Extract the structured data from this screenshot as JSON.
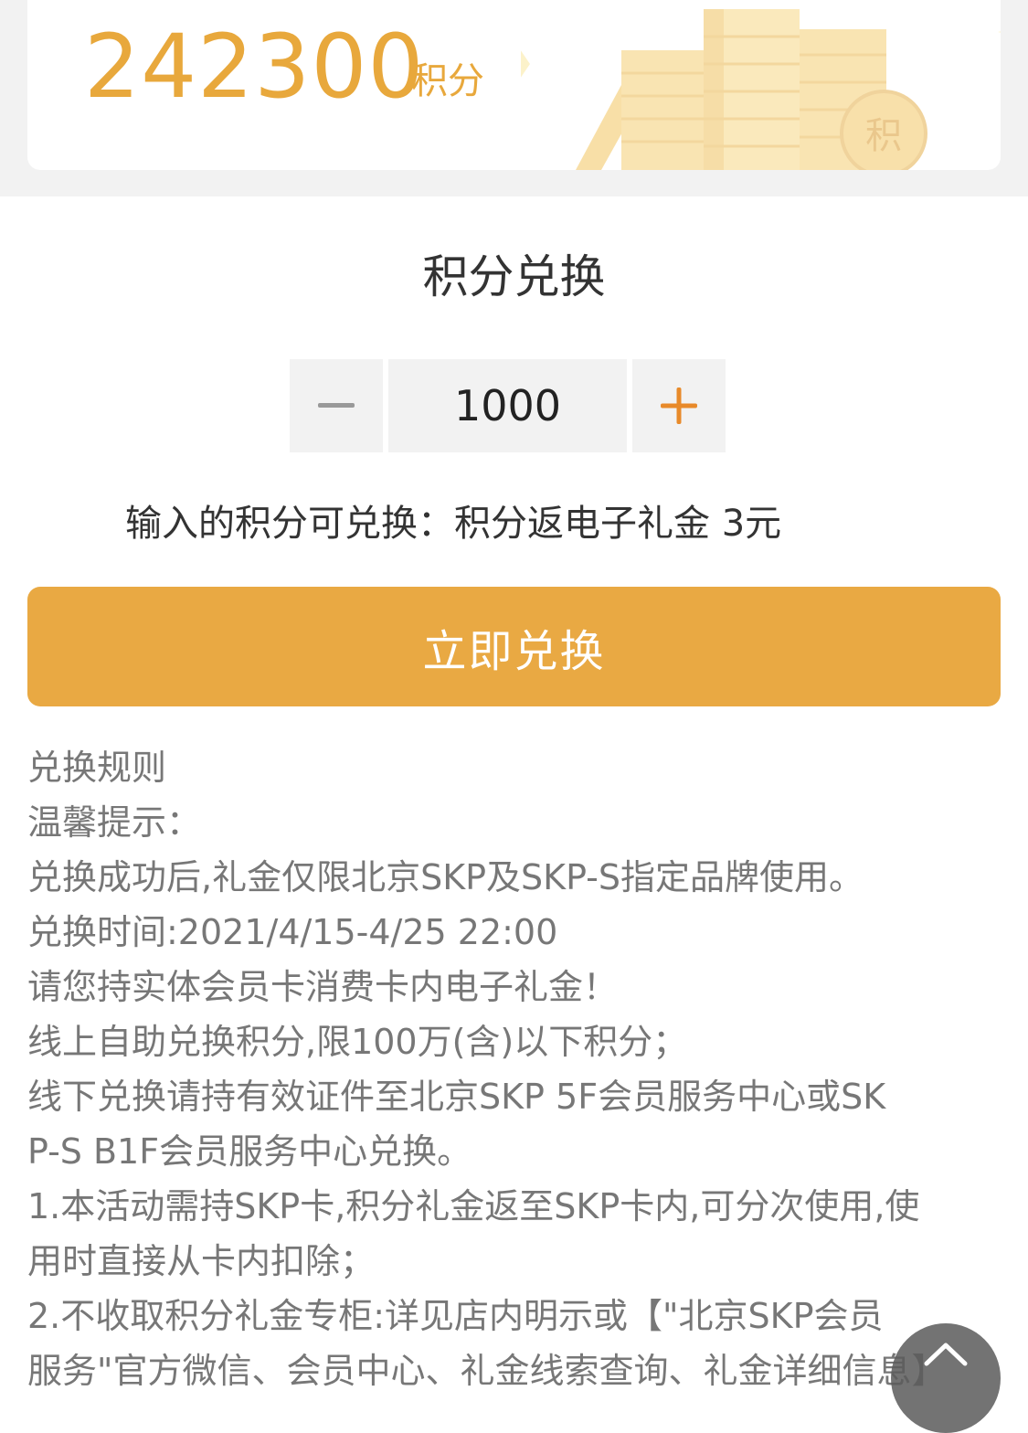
{
  "points": {
    "value": "242300",
    "unit": "积分",
    "illustration_glyph": "积"
  },
  "exchange": {
    "title": "积分兑换",
    "quantity": "1000",
    "minus_label": "−",
    "plus_label": "+",
    "result_text": "输入的积分可兑换：积分返电子礼金 3元",
    "redeem_label": "立即兑换"
  },
  "rules": {
    "title": "兑换规则",
    "lines": [
      "温馨提示：",
      "兑换成功后,礼金仅限北京SKP及SKP-S指定品牌使用。",
      "兑换时间:2021/4/15-4/25 22:00",
      "请您持实体会员卡消费卡内电子礼金！",
      "线上自助兑换积分,限100万(含)以下积分；",
      "线下兑换请持有效证件至北京SKP 5F会员服务中心或SK",
      "P-S B1F会员服务中心兑换。",
      "1.本活动需持SKP卡,积分礼金返至SKP卡内,可分次使用,使",
      "用时直接从卡内扣除；",
      "2.不收取积分礼金专柜:详见店内明示或【\"北京SKP会员",
      "服务\"官方微信、会员中心、礼金线索查询、礼金详细信息】"
    ]
  },
  "colors": {
    "accent": "#e8a83c",
    "button": "#e9a943",
    "plus": "#e88a2a"
  },
  "icons": {
    "scroll_top": "chevron-up-icon",
    "minus": "minus-icon",
    "plus": "plus-icon"
  }
}
